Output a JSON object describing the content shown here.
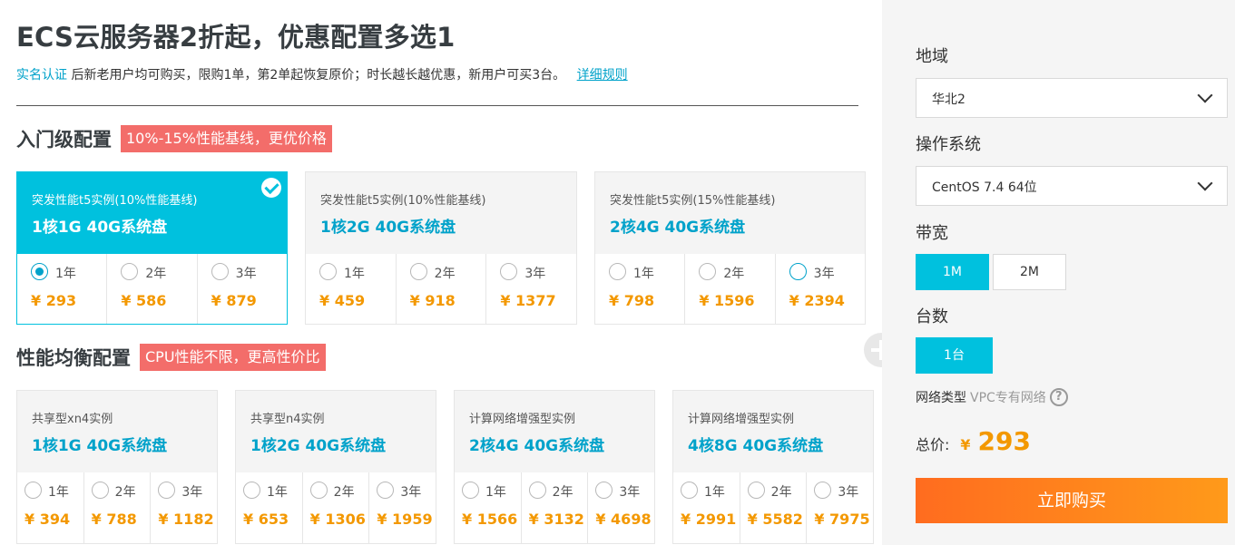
{
  "header": {
    "title": "ECS云服务器2折起，优惠配置多选1",
    "realname_link": "实名认证",
    "description": "后新老用户均可购买，限购1单，第2单起恢复原价；时长越长越优惠，新用户可买3台。",
    "rules_link": "详细规则"
  },
  "colors": {
    "accent": "#00c1de",
    "link": "#00a2ca",
    "price": "#f39800",
    "tag": "#f36d6a",
    "buy_start": "#ff6c1f",
    "buy_end": "#ff9a1a"
  },
  "entry": {
    "title": "入门级配置",
    "tag": "10%-15%性能基线，更优价格",
    "cards": [
      {
        "type": "突发性能t5实例(10%性能基线)",
        "spec": "1核1G 40G系统盘",
        "options": [
          {
            "year": "1年",
            "price": "¥ 293"
          },
          {
            "year": "2年",
            "price": "¥ 586"
          },
          {
            "year": "3年",
            "price": "¥ 879"
          }
        ]
      },
      {
        "type": "突发性能t5实例(10%性能基线)",
        "spec": "1核2G 40G系统盘",
        "options": [
          {
            "year": "1年",
            "price": "¥ 459"
          },
          {
            "year": "2年",
            "price": "¥ 918"
          },
          {
            "year": "3年",
            "price": "¥ 1377"
          }
        ]
      },
      {
        "type": "突发性能t5实例(15%性能基线)",
        "spec": "2核4G 40G系统盘",
        "options": [
          {
            "year": "1年",
            "price": "¥ 798"
          },
          {
            "year": "2年",
            "price": "¥ 1596"
          },
          {
            "year": "3年",
            "price": "¥ 2394"
          }
        ]
      }
    ]
  },
  "balanced": {
    "title": "性能均衡配置",
    "tag": "CPU性能不限，更高性价比",
    "cards": [
      {
        "type": "共享型xn4实例",
        "spec": "1核1G 40G系统盘",
        "options": [
          {
            "year": "1年",
            "price": "¥ 394"
          },
          {
            "year": "2年",
            "price": "¥ 788"
          },
          {
            "year": "3年",
            "price": "¥ 1182"
          }
        ]
      },
      {
        "type": "共享型n4实例",
        "spec": "1核2G 40G系统盘",
        "options": [
          {
            "year": "1年",
            "price": "¥ 653"
          },
          {
            "year": "2年",
            "price": "¥ 1306"
          },
          {
            "year": "3年",
            "price": "¥ 1959"
          }
        ]
      },
      {
        "type": "计算网络增强型实例",
        "spec": "2核4G 40G系统盘",
        "options": [
          {
            "year": "1年",
            "price": "¥ 1566"
          },
          {
            "year": "2年",
            "price": "¥ 3132"
          },
          {
            "year": "3年",
            "price": "¥ 4698"
          }
        ]
      },
      {
        "type": "计算网络增强型实例",
        "spec": "4核8G 40G系统盘",
        "options": [
          {
            "year": "1年",
            "price": "¥ 2991"
          },
          {
            "year": "2年",
            "price": "¥ 5582"
          },
          {
            "year": "3年",
            "price": "¥ 7975"
          }
        ]
      }
    ]
  },
  "sidebar": {
    "region_label": "地域",
    "region_value": "华北2",
    "os_label": "操作系统",
    "os_value": "CentOS 7.4 64位",
    "bandwidth_label": "带宽",
    "bandwidth_options": [
      "1M",
      "2M"
    ],
    "count_label": "台数",
    "count_value": "1台",
    "network_label": "网络类型",
    "network_value": "VPC专有网络",
    "help_symbol": "?",
    "total_label": "总价:",
    "currency": "¥",
    "total_value": "293",
    "buy_label": "立即购买"
  }
}
